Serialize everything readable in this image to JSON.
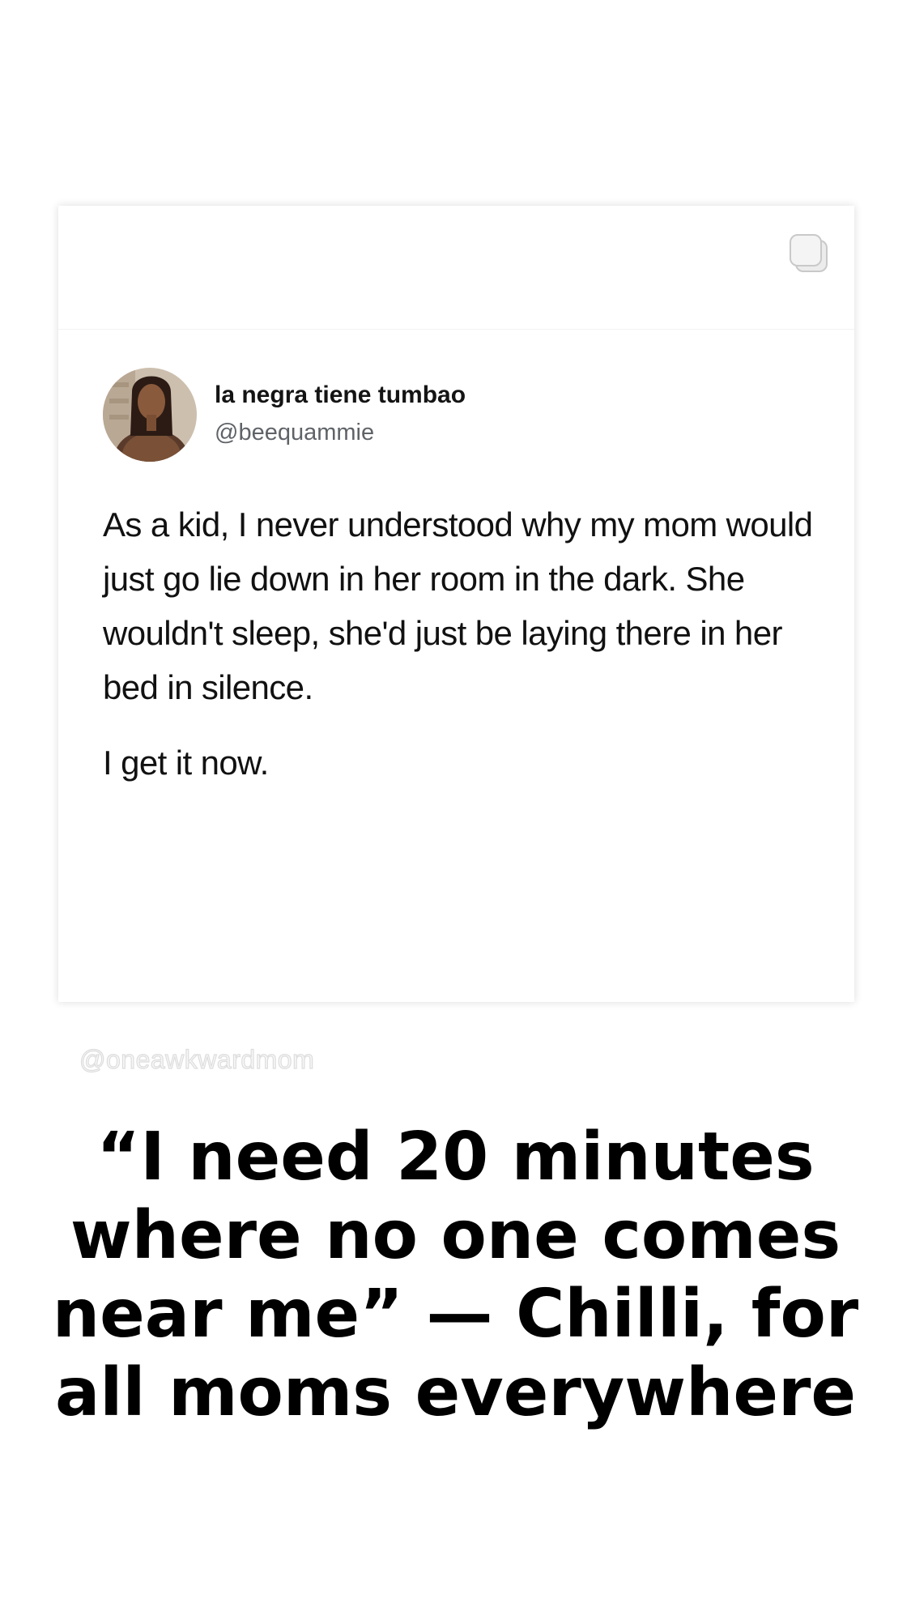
{
  "tweet": {
    "display_name": "la negra tiene tumbao",
    "handle": "@beequammie",
    "body_paragraph_1": "As a kid, I never understood why my mom would just go lie down in her room in the dark. She wouldn't sleep, she'd just be laying there in her bed in silence.",
    "body_paragraph_2": "I get it now.",
    "avatar_icon": "profile-photo",
    "multi_image_icon": "copy-stack-icon"
  },
  "watermark": {
    "text": "@oneawkwardmom"
  },
  "caption": {
    "text": "“I need 20 minutes where no one comes near me” — Chilli, for all moms everywhere"
  },
  "colors": {
    "background": "#ffffff",
    "card": "#ffffff",
    "name_text": "#141414",
    "handle_text": "#5f6368",
    "body_text": "#111111",
    "caption_text": "#000000"
  }
}
